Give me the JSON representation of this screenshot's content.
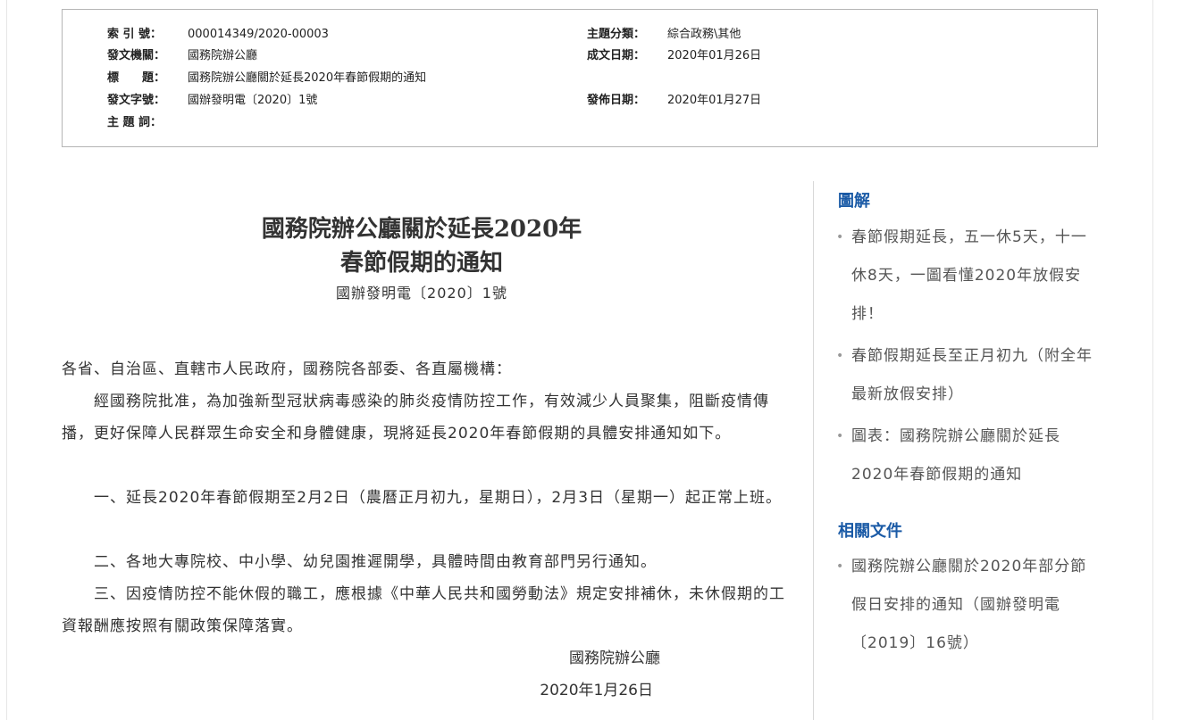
{
  "meta": {
    "index_label": "索 引 號：",
    "index_value": "000014349/2020-00003",
    "issuer_label": "發文機關：",
    "issuer_value": "國務院辦公廳",
    "title_label": "標　　題：",
    "title_value": "國務院辦公廳關於延長2020年春節假期的通知",
    "docno_label": "發文字號：",
    "docno_value": "國辦發明電〔2020〕1號",
    "keywords_label": "主 題 詞：",
    "keywords_value": "",
    "category_label": "主題分類：",
    "category_value": "綜合政務\\其他",
    "written_label": "成文日期：",
    "written_value": "2020年01月26日",
    "published_label": "發佈日期：",
    "published_value": "2020年01月27日"
  },
  "article": {
    "title_line1": "國務院辦公廳關於延長2020年",
    "title_line2": "春節假期的通知",
    "doc_number": "國辦發明電〔2020〕1號",
    "salutation": "各省、自治區、直轄市人民政府，國務院各部委、各直屬機構：",
    "p1": "經國務院批准，為加強新型冠狀病毒感染的肺炎疫情防控工作，有效減少人員聚集，阻斷疫情傳播，更好保障人民群眾生命安全和身體健康，現將延長2020年春節假期的具體安排通知如下。",
    "p2": "一、延長2020年春節假期至2月2日（農曆正月初九，星期日），2月3日（星期一）起正常上班。",
    "p3": "二、各地大專院校、中小學、幼兒園推遲開學，具體時間由教育部門另行通知。",
    "p4": "三、因疫情防控不能休假的職工，應根據《中華人民共和國勞動法》規定安排補休，未休假期的工資報酬應按照有關政策保障落實。",
    "signature": "國務院辦公廳",
    "date": "2020年1月26日"
  },
  "sidebar": {
    "infographics_heading": "圖解",
    "infographics": [
      "春節假期延長，五一休5天，十一休8天，一圖看懂2020年放假安排！",
      "春節假期延長至正月初九（附全年最新放假安排）",
      "圖表：國務院辦公廳關於延長2020年春節假期的通知"
    ],
    "related_heading": "相關文件",
    "related": [
      "國務院辦公廳關於2020年部分節假日安排的通知（國辦發明電〔2019〕16號）"
    ]
  }
}
